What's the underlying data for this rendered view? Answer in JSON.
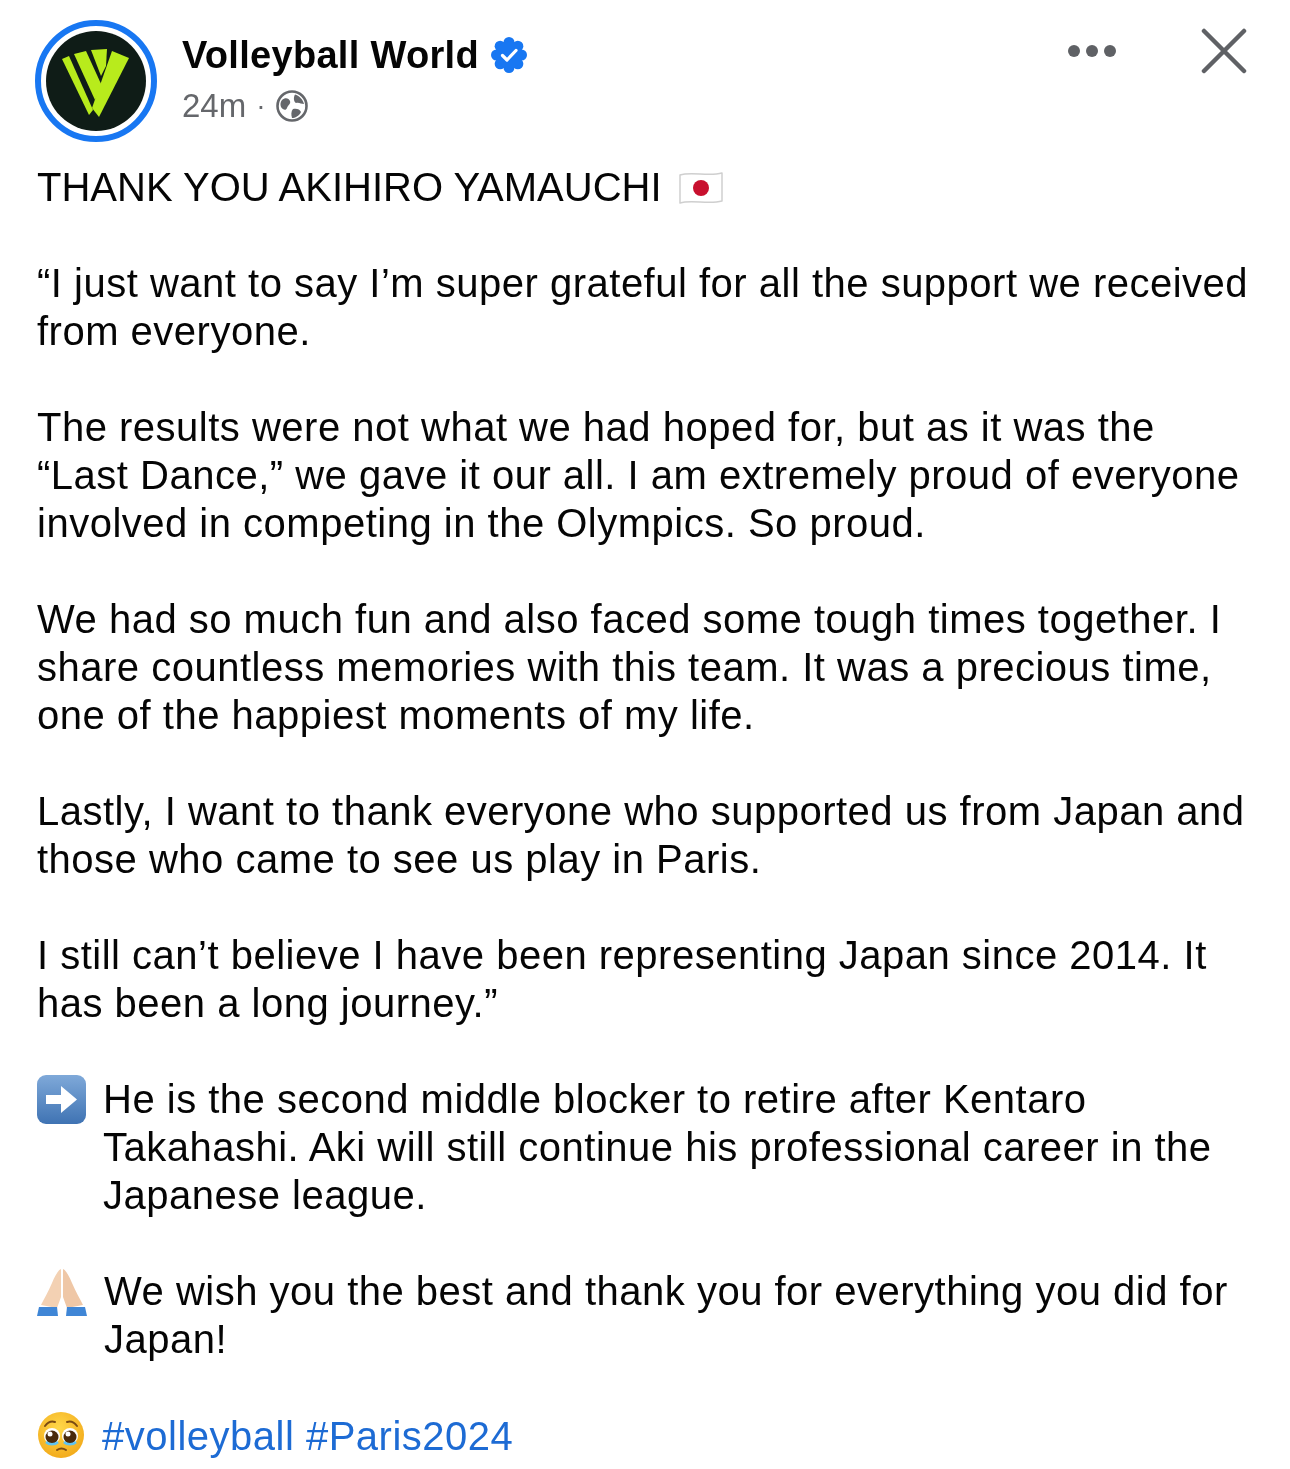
{
  "post": {
    "author": {
      "name": "Volleyball World",
      "verified": true
    },
    "time": "24m",
    "separator": "·"
  },
  "body": [
    {
      "kind": "heading",
      "text": "THANK YOU AKIHIRO YAMAUCHI"
    },
    {
      "kind": "plain",
      "text": "“I just want to say I’m super grateful for all the support we received from everyone."
    },
    {
      "kind": "plain",
      "text": "The results were not what we had hoped for, but as it was the “Last Dance,” we gave it our all. I am extremely proud of everyone involved in competing in the Olympics. So proud."
    },
    {
      "kind": "plain",
      "text": "We had so much fun and also faced some tough times together. I share countless memories with this team. It was a precious time, one of the happiest moments of my life."
    },
    {
      "kind": "plain",
      "text": "Lastly, I want to thank everyone who supported us from Japan and those who came to see us play in Paris."
    },
    {
      "kind": "plain",
      "text": "I still can’t believe I have been representing Japan since 2014. It has been a long journey.”"
    },
    {
      "kind": "arrow",
      "text": "He is the second middle blocker to retire after Kentaro Takahashi. Aki will still continue his professional career in the Japanese league."
    },
    {
      "kind": "prayer",
      "text": "We wish you the best and thank you for everything you did for Japan!"
    },
    {
      "kind": "tags",
      "tags": [
        "#volleyball",
        "#Paris2024"
      ]
    }
  ]
}
